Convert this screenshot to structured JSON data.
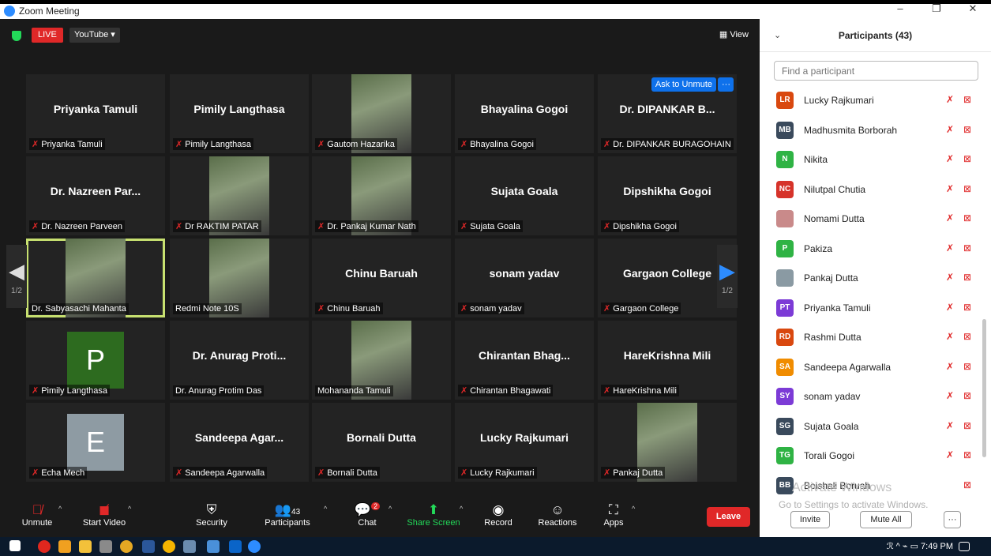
{
  "window": {
    "title": "Zoom Meeting",
    "minimize": "–",
    "restore": "❐",
    "close": "✕"
  },
  "topbar": {
    "live_label": "LIVE",
    "stream_label": "YouTube ▾",
    "view_label": "View"
  },
  "tiles": [
    {
      "big": "Priyanka Tamuli",
      "name": "Priyanka Tamuli",
      "muted": true
    },
    {
      "big": "Pimily Langthasa",
      "name": "Pimily Langthasa",
      "muted": true
    },
    {
      "big": "",
      "name": "Gautom Hazarika",
      "muted": true,
      "photo": true
    },
    {
      "big": "Bhayalina Gogoi",
      "name": "Bhayalina Gogoi",
      "muted": true
    },
    {
      "big": "Dr. DIPANKAR B...",
      "name": "Dr. DIPANKAR BURAGOHAIN",
      "muted": true,
      "ask_to_unmute": "Ask to Unmute",
      "more": "···"
    },
    {
      "big": "Dr. Nazreen Par...",
      "name": "Dr. Nazreen Parveen",
      "muted": true
    },
    {
      "big": "",
      "name": "Dr RAKTIM PATAR",
      "muted": true,
      "photo": true
    },
    {
      "big": "",
      "name": "Dr. Pankaj Kumar Nath",
      "muted": true,
      "photo": true
    },
    {
      "big": "Sujata Goala",
      "name": "Sujata Goala",
      "muted": true
    },
    {
      "big": "Dipshikha Gogoi",
      "name": "Dipshikha Gogoi",
      "muted": true
    },
    {
      "big": "",
      "name": "Dr. Sabyasachi Mahanta",
      "muted": false,
      "photo": true,
      "active": true
    },
    {
      "big": "",
      "name": "Redmi Note 10S",
      "muted": false,
      "photo": true
    },
    {
      "big": "Chinu Baruah",
      "name": "Chinu Baruah",
      "muted": true
    },
    {
      "big": "sonam yadav",
      "name": "sonam yadav",
      "muted": true
    },
    {
      "big": "Gargaon College",
      "name": "Gargaon College",
      "muted": true
    },
    {
      "big": "",
      "name": "Pimily Langthasa",
      "muted": true,
      "avatar": "P",
      "avatar_color": "#2d6b1f"
    },
    {
      "big": "Dr. Anurag Proti...",
      "name": "Dr. Anurag Protim Das",
      "muted": false
    },
    {
      "big": "",
      "name": "Mohananda Tamuli",
      "muted": false,
      "photo": true
    },
    {
      "big": "Chirantan  Bhag...",
      "name": "Chirantan Bhagawati",
      "muted": true
    },
    {
      "big": "HareKrishna Mili",
      "name": "HareKrishna Mili",
      "muted": true
    },
    {
      "big": "",
      "name": "Echa Mech",
      "muted": true,
      "avatar": "E",
      "avatar_color": "#8e9ba3"
    },
    {
      "big": "Sandeepa  Agar...",
      "name": "Sandeepa Agarwalla",
      "muted": true
    },
    {
      "big": "Bornali Dutta",
      "name": "Bornali Dutta",
      "muted": true
    },
    {
      "big": "Lucky Rajkumari",
      "name": "Lucky Rajkumari",
      "muted": true
    },
    {
      "big": "",
      "name": "Pankaj Dutta",
      "muted": true,
      "photo": true
    }
  ],
  "pagination": {
    "left_page": "1/2",
    "right_page": "1/2"
  },
  "toolbar": {
    "unmute": "Unmute",
    "start_video": "Start Video",
    "security": "Security",
    "participants": "Participants",
    "participants_count": "43",
    "chat": "Chat",
    "chat_badge": "2",
    "share_screen": "Share Screen",
    "record": "Record",
    "reactions": "Reactions",
    "apps": "Apps",
    "leave": "Leave"
  },
  "panel": {
    "title": "Participants (43)",
    "search_placeholder": "Find a participant",
    "participants": [
      {
        "initials": "LR",
        "name": "Lucky Rajkumari",
        "color": "#d9480f"
      },
      {
        "initials": "MB",
        "name": "Madhusmita Borborah",
        "color": "#3a4a5c"
      },
      {
        "initials": "N",
        "name": "Nikita",
        "color": "#2fb344"
      },
      {
        "initials": "NC",
        "name": "Nilutpal Chutia",
        "color": "#d6332a"
      },
      {
        "initials": "",
        "name": "Nomami Dutta",
        "color": "#c98a8a"
      },
      {
        "initials": "P",
        "name": "Pakiza",
        "color": "#2fb344"
      },
      {
        "initials": "",
        "name": "Pankaj Dutta",
        "color": "#8a9aa3"
      },
      {
        "initials": "PT",
        "name": "Priyanka Tamuli",
        "color": "#7c3bd6"
      },
      {
        "initials": "RD",
        "name": "Rashmi Dutta",
        "color": "#d9480f"
      },
      {
        "initials": "SA",
        "name": "Sandeepa Agarwalla",
        "color": "#f08c00"
      },
      {
        "initials": "SY",
        "name": "sonam yadav",
        "color": "#7c3bd6"
      },
      {
        "initials": "SG",
        "name": "Sujata Goala",
        "color": "#3a4a5c"
      },
      {
        "initials": "TG",
        "name": "Torali Gogoi",
        "color": "#2fb344"
      },
      {
        "initials": "BB",
        "name": "Boishali Boruah",
        "color": "#3a4a5c"
      }
    ],
    "watermark_line1": "Activate Windows",
    "watermark_line2": "Go to Settings to activate Windows.",
    "invite": "Invite",
    "mute_all": "Mute All",
    "more": "···"
  },
  "taskbar": {
    "time": "7:49 PM"
  }
}
